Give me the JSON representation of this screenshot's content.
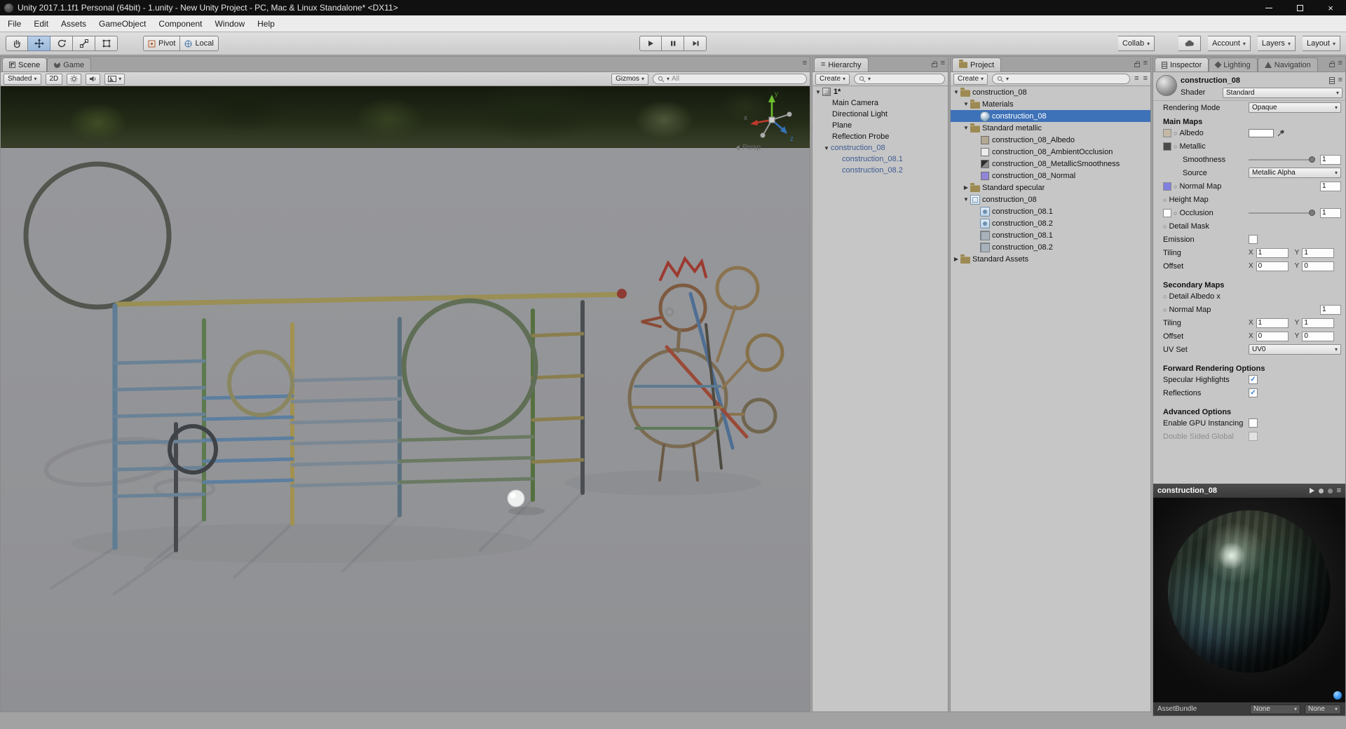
{
  "window": {
    "title": "Unity 2017.1.1f1 Personal (64bit) - 1.unity - New Unity Project - PC, Mac & Linux Standalone* <DX11>"
  },
  "menubar": {
    "items": [
      "File",
      "Edit",
      "Assets",
      "GameObject",
      "Component",
      "Window",
      "Help"
    ]
  },
  "toolbar": {
    "pivot": "Pivot",
    "local": "Local",
    "collab": "Collab",
    "account": "Account",
    "layers": "Layers",
    "layout": "Layout"
  },
  "scene": {
    "tab_scene": "Scene",
    "tab_game": "Game",
    "shaded": "Shaded",
    "mode_2d": "2D",
    "gizmos": "Gizmos",
    "search_text": "All",
    "persp": "Persp",
    "axis_x": "x",
    "axis_y": "y",
    "axis_z": "z"
  },
  "hierarchy": {
    "tab": "Hierarchy",
    "create": "Create",
    "scene_row": "1*",
    "items": [
      {
        "label": "Main Camera"
      },
      {
        "label": "Directional Light"
      },
      {
        "label": "Plane"
      },
      {
        "label": "Reflection Probe"
      },
      {
        "label": "construction_08"
      },
      {
        "label": "construction_08.1"
      },
      {
        "label": "construction_08.2"
      }
    ]
  },
  "project": {
    "tab": "Project",
    "create": "Create",
    "items": [
      {
        "label": "construction_08"
      },
      {
        "label": "Materials"
      },
      {
        "label": "construction_08"
      },
      {
        "label": "Standard metallic"
      },
      {
        "label": "construction_08_Albedo"
      },
      {
        "label": "construction_08_AmbientOcclusion"
      },
      {
        "label": "construction_08_MetallicSmoothness"
      },
      {
        "label": "construction_08_Normal"
      },
      {
        "label": "Standard specular"
      },
      {
        "label": "construction_08"
      },
      {
        "label": "construction_08.1"
      },
      {
        "label": "construction_08.2"
      },
      {
        "label": "construction_08.1"
      },
      {
        "label": "construction_08.2"
      },
      {
        "label": "Standard Assets"
      }
    ]
  },
  "inspector": {
    "tab_inspector": "Inspector",
    "tab_lighting": "Lighting",
    "tab_navigation": "Navigation",
    "material_name": "construction_08",
    "shader_label": "Shader",
    "shader_value": "Standard",
    "rendering_mode_label": "Rendering Mode",
    "rendering_mode_value": "Opaque",
    "main_maps": "Main Maps",
    "albedo": "Albedo",
    "metallic": "Metallic",
    "smoothness": "Smoothness",
    "smoothness_value": "1",
    "source": "Source",
    "source_value": "Metallic Alpha",
    "normal_map": "Normal Map",
    "normal_value": "1",
    "height_map": "Height Map",
    "occlusion": "Occlusion",
    "occlusion_value": "1",
    "detail_mask": "Detail Mask",
    "emission": "Emission",
    "tiling": "Tiling",
    "offset": "Offset",
    "axis_x": "X",
    "axis_y": "Y",
    "tiling_x": "1",
    "tiling_y": "1",
    "offset_x": "0",
    "offset_y": "0",
    "secondary_maps": "Secondary Maps",
    "detail_albedo": "Detail Albedo x",
    "normal_map2": "Normal Map",
    "normal2_value": "1",
    "tiling2_x": "1",
    "tiling2_y": "1",
    "offset2_x": "0",
    "offset2_y": "0",
    "uv_set": "UV Set",
    "uv_set_value": "UV0",
    "forward_options": "Forward Rendering Options",
    "specular_highlights": "Specular Highlights",
    "reflections": "Reflections",
    "advanced_options": "Advanced Options",
    "gpu_instancing": "Enable GPU Instancing",
    "double_sided": "Double Sided Global",
    "preview_title": "construction_08",
    "assetbundle": "AssetBundle",
    "assetbundle_none1": "None",
    "assetbundle_none2": "None"
  }
}
